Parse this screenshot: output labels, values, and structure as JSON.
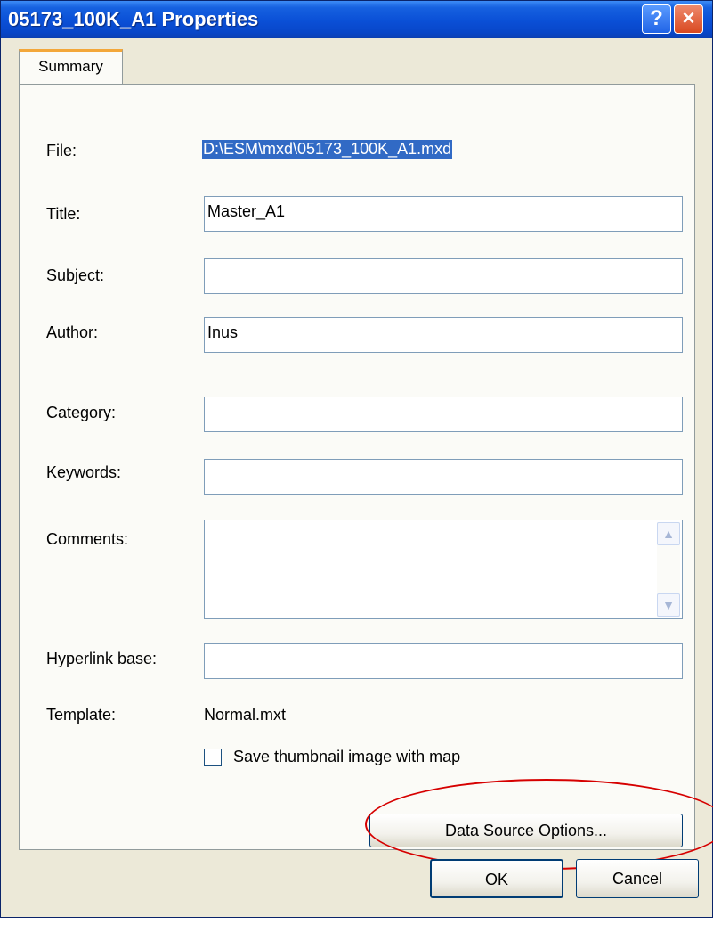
{
  "window": {
    "title": "05173_100K_A1 Properties",
    "help_glyph": "?",
    "close_glyph": "×"
  },
  "tabs": [
    {
      "label": "Summary"
    }
  ],
  "form": {
    "file_label": "File:",
    "file_value": "D:\\ESM\\mxd\\05173_100K_A1.mxd",
    "title_label": "Title:",
    "title_value": "Master_A1",
    "subject_label": "Subject:",
    "subject_value": "",
    "author_label": "Author:",
    "author_value": "Inus",
    "category_label": "Category:",
    "category_value": "",
    "keywords_label": "Keywords:",
    "keywords_value": "",
    "comments_label": "Comments:",
    "comments_value": "",
    "hyperlink_label": "Hyperlink base:",
    "hyperlink_value": "",
    "template_label": "Template:",
    "template_value": "Normal.mxt",
    "thumbnail_label": "Save thumbnail image with map",
    "thumbnail_checked": false,
    "data_source_button": "Data Source Options..."
  },
  "footer": {
    "ok_label": "OK",
    "cancel_label": "Cancel"
  },
  "colors": {
    "titlebar": "#0a4fd6",
    "selection": "#316ac5",
    "annotation_ellipse": "#d60000"
  }
}
